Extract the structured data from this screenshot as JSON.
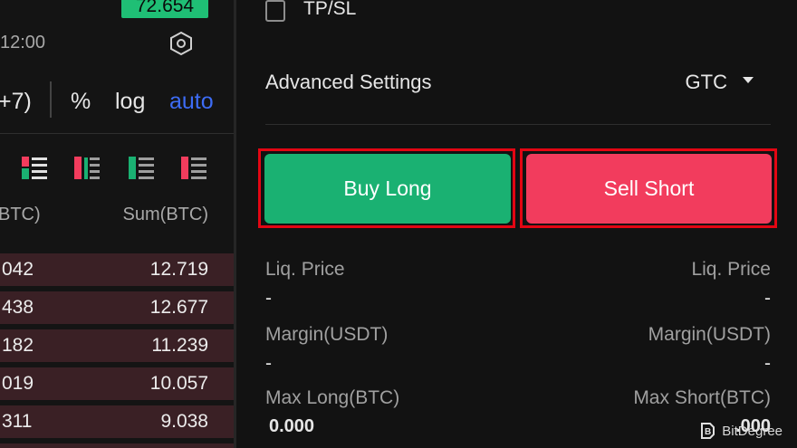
{
  "chart_header": {
    "price_tag": "72.654",
    "time_label": "12:00",
    "settings_icon": "hexagon-settings-icon"
  },
  "chart_toolbar": {
    "interval": "+7)",
    "percent": "%",
    "log": "log",
    "auto": "auto",
    "auto_color": "#3d6cf5"
  },
  "orderbook": {
    "view_icons": [
      "orderbook-both-icon",
      "orderbook-buy-icon",
      "orderbook-sell-icon",
      "orderbook-list-icon"
    ],
    "columns": {
      "size": "BTC)",
      "sum": "Sum(BTC)"
    },
    "rows": [
      {
        "size": "042",
        "sum": "12.719"
      },
      {
        "size": "438",
        "sum": "12.677"
      },
      {
        "size": "182",
        "sum": "11.239"
      },
      {
        "size": "019",
        "sum": "10.057"
      },
      {
        "size": "311",
        "sum": "9.038"
      }
    ],
    "row_color": "#3a2025"
  },
  "order_form": {
    "tpsl_label": "TP/SL",
    "advanced_label": "Advanced Settings",
    "tif_value": "GTC",
    "buy_label": "Buy Long",
    "sell_label": "Sell Short",
    "buy_color": "#1ab172",
    "sell_color": "#f23c5d",
    "highlight_color": "#e30613",
    "info": {
      "liq_left_label": "Liq. Price",
      "liq_left_value": "-",
      "liq_right_label": "Liq. Price",
      "liq_right_value": "-",
      "margin_left_label": "Margin(USDT)",
      "margin_left_value": "-",
      "margin_right_label": "Margin(USDT)",
      "margin_right_value": "-",
      "max_long_label": "Max Long(BTC)",
      "max_long_value": "0.000",
      "max_short_label": "Max Short(BTC)",
      "max_short_value": ".000"
    }
  },
  "watermark": {
    "text": "BitDegree",
    "logo_icon": "bitdegree-logo-icon"
  }
}
